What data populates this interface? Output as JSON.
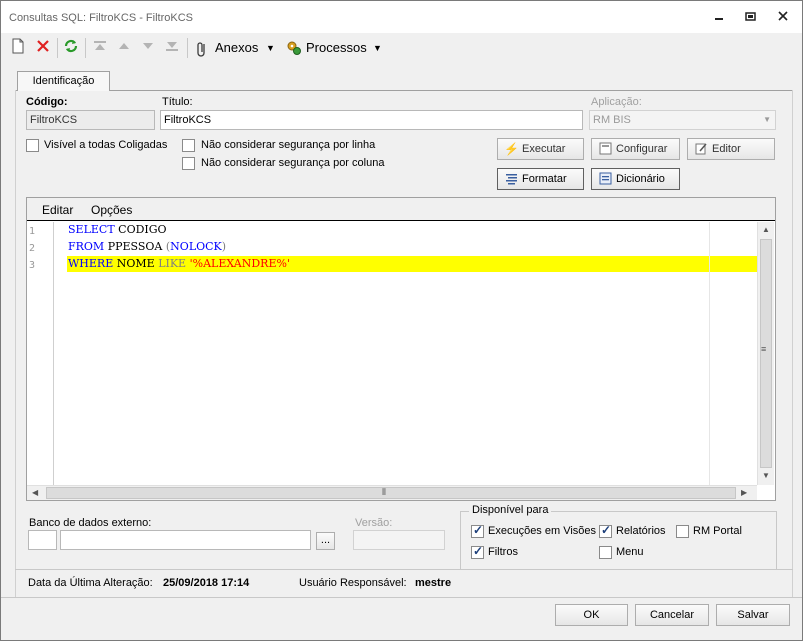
{
  "window": {
    "title": "Consultas SQL: FiltroKCS - FiltroKCS"
  },
  "toolbar": {
    "anexos_label": "Anexos",
    "processos_label": "Processos"
  },
  "tabs": [
    {
      "label": "Identificação",
      "active": true
    }
  ],
  "form": {
    "codigo_label": "Código:",
    "codigo_value": "FiltroKCS",
    "titulo_label": "Título:",
    "titulo_value": "FiltroKCS",
    "aplicacao_label": "Aplicação:",
    "aplicacao_value": "RM BIS",
    "visivel_label": "Visível a todas Coligadas",
    "visivel_checked": false,
    "seg_linha_label": "Não considerar segurança por linha",
    "seg_linha_checked": false,
    "seg_coluna_label": "Não considerar segurança por coluna",
    "seg_coluna_checked": false
  },
  "buttons": {
    "executar": "Executar",
    "configurar": "Configurar",
    "editor": "Editor",
    "formatar": "Formatar",
    "dicionario": "Dicionário"
  },
  "editor": {
    "menu": [
      "Editar",
      "Opções"
    ],
    "line_numbers": [
      "1",
      "2",
      "3"
    ],
    "lines": [
      {
        "tokens": [
          {
            "t": "SELECT",
            "c": "kw"
          },
          {
            "t": " CODIGO",
            "c": "tx"
          }
        ]
      },
      {
        "tokens": [
          {
            "t": "FROM",
            "c": "kw"
          },
          {
            "t": " PPESSOA ",
            "c": "tx"
          },
          {
            "t": "(",
            "c": "gr"
          },
          {
            "t": "NOLOCK",
            "c": "kw"
          },
          {
            "t": ")",
            "c": "gr"
          }
        ]
      },
      {
        "tokens": [
          {
            "t": "WHERE",
            "c": "kw"
          },
          {
            "t": " NOME ",
            "c": "tx"
          },
          {
            "t": "LIKE",
            "c": "gr"
          },
          {
            "t": " ",
            "c": "tx"
          },
          {
            "t": "'%ALEXANDRE%'",
            "c": "st"
          }
        ]
      }
    ],
    "highlighted_line": 3
  },
  "external_db": {
    "label": "Banco de dados externo:",
    "browse_label": "...",
    "versao_label": "Versão:"
  },
  "disponivel": {
    "legend": "Disponível para",
    "options": [
      {
        "label": "Execuções em Visões",
        "checked": true
      },
      {
        "label": "Relatórios",
        "checked": true
      },
      {
        "label": "RM Portal",
        "checked": false
      },
      {
        "label": "Filtros",
        "checked": true
      },
      {
        "label": "Menu",
        "checked": false
      }
    ]
  },
  "footer": {
    "data_label": "Data da Última Alteração:",
    "data_value": "25/09/2018 17:14",
    "usuario_label": "Usuário Responsável:",
    "usuario_value": "mestre"
  },
  "dialog_buttons": {
    "ok": "OK",
    "cancelar": "Cancelar",
    "salvar": "Salvar"
  },
  "colors": {
    "keyword": "#0000ff",
    "string": "#ff0000",
    "operator": "#808080",
    "highlight": "#ffff00"
  }
}
